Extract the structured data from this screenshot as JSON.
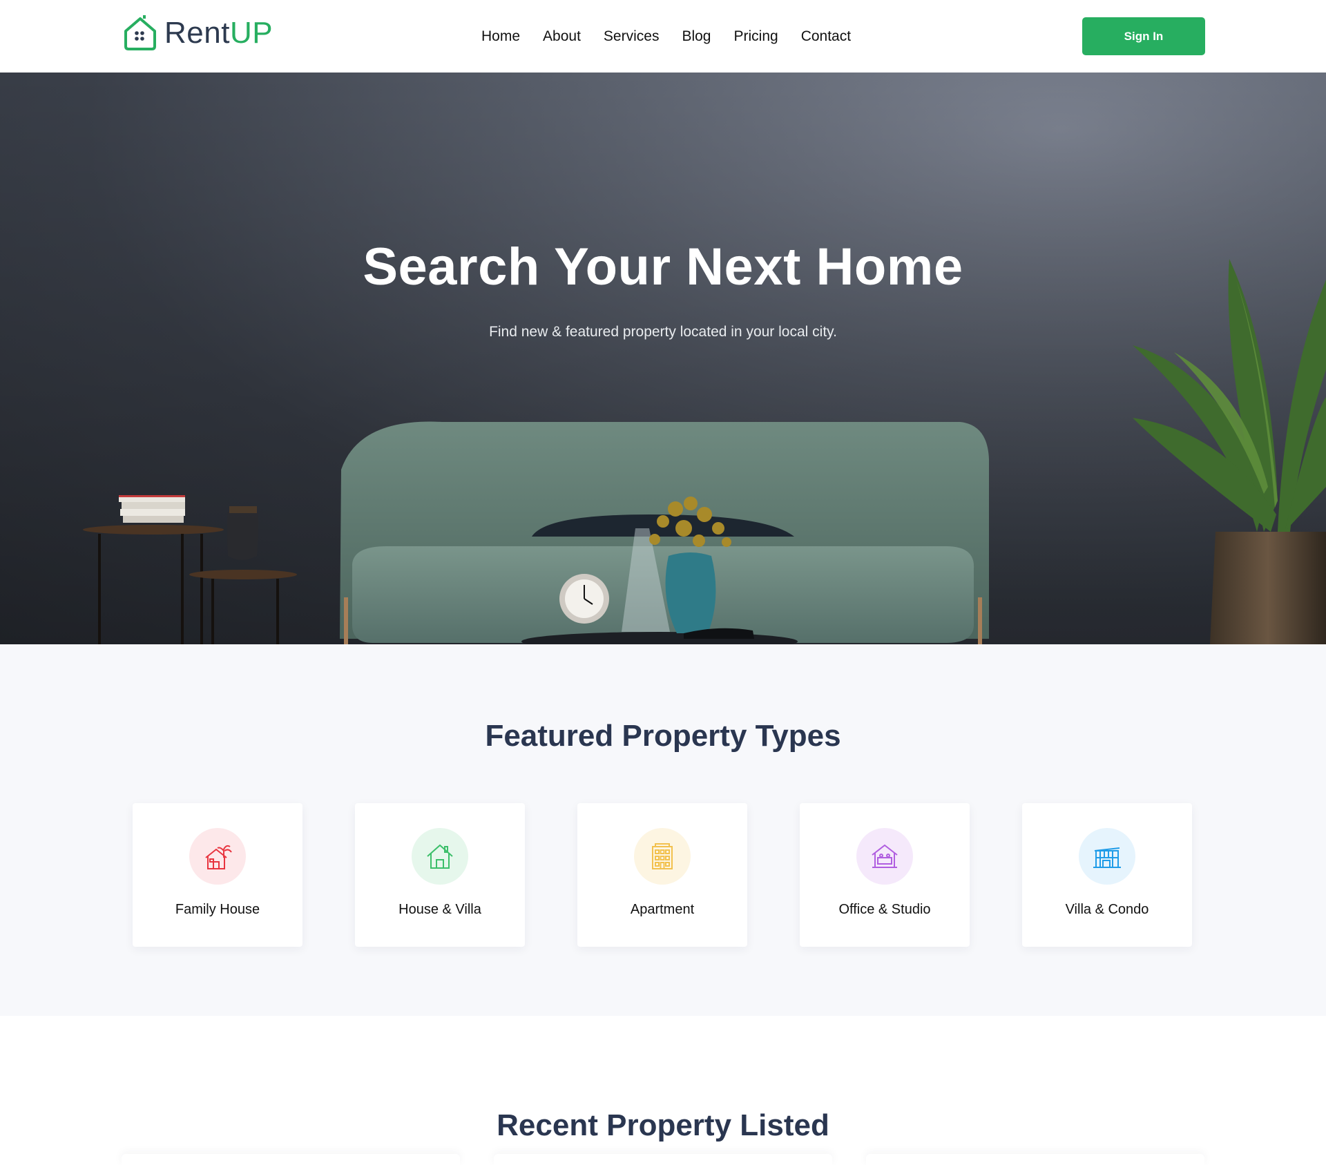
{
  "brand": {
    "name_part1": "Rent",
    "name_part2": "UP",
    "accent_color": "#27ae60"
  },
  "nav": {
    "items": [
      {
        "label": "Home"
      },
      {
        "label": "About"
      },
      {
        "label": "Services"
      },
      {
        "label": "Blog"
      },
      {
        "label": "Pricing"
      },
      {
        "label": "Contact"
      }
    ]
  },
  "header": {
    "signin_label": "Sign In"
  },
  "hero": {
    "title": "Search Your Next Home",
    "subtitle": "Find new & featured property located in your local city."
  },
  "featured": {
    "title": "Featured Property Types",
    "types": [
      {
        "label": "Family House",
        "icon": "family-house-icon",
        "color": "#e8343f",
        "bg": "#fde8ea"
      },
      {
        "label": "House & Villa",
        "icon": "house-villa-icon",
        "color": "#3cbf6a",
        "bg": "#e6f7ec"
      },
      {
        "label": "Apartment",
        "icon": "apartment-icon",
        "color": "#f2c14e",
        "bg": "#fdf5e2"
      },
      {
        "label": "Office & Studio",
        "icon": "office-studio-icon",
        "color": "#b05ee0",
        "bg": "#f5e9fb"
      },
      {
        "label": "Villa & Condo",
        "icon": "villa-condo-icon",
        "color": "#1f9ce8",
        "bg": "#e6f4fd"
      }
    ]
  },
  "recent": {
    "title": "Recent Property Listed"
  }
}
